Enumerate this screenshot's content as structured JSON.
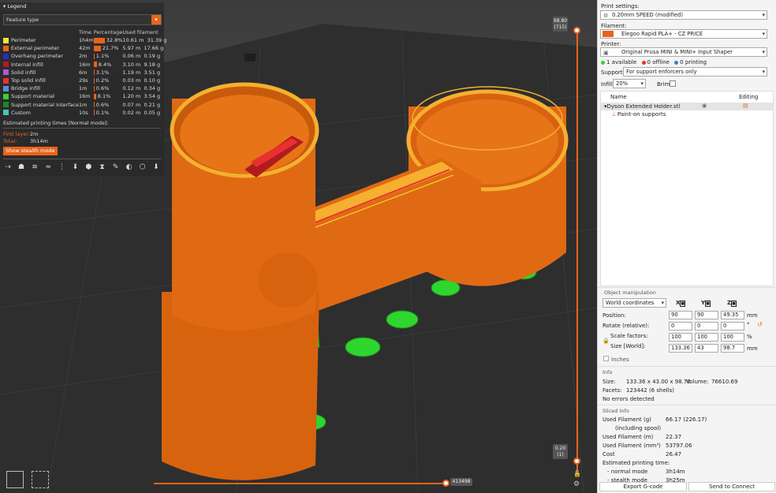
{
  "legend": {
    "title": "Legend",
    "view_type": "Feature type",
    "columns": [
      "Time",
      "Percentage",
      "Used filament"
    ],
    "rows": [
      {
        "name": "Perimeter",
        "color": "#f5e43a",
        "time": "1h4m",
        "pct": "32.8%",
        "pct_value": 32.8,
        "len": "10.61 m",
        "weight": "31.39 g"
      },
      {
        "name": "External perimeter",
        "color": "#e8641b",
        "time": "42m",
        "pct": "21.7%",
        "pct_value": 21.7,
        "len": "5.97 m",
        "weight": "17.66 g"
      },
      {
        "name": "Overhang perimeter",
        "color": "#2a2acc",
        "time": "2m",
        "pct": "1.1%",
        "pct_value": 1.1,
        "len": "0.06 m",
        "weight": "0.19 g"
      },
      {
        "name": "Internal infill",
        "color": "#b01c1c",
        "time": "16m",
        "pct": "8.4%",
        "pct_value": 8.4,
        "len": "3.10 m",
        "weight": "9.18 g"
      },
      {
        "name": "Solid infill",
        "color": "#a65ad6",
        "time": "6m",
        "pct": "3.1%",
        "pct_value": 3.1,
        "len": "1.19 m",
        "weight": "3.51 g"
      },
      {
        "name": "Top solid infill",
        "color": "#e83030",
        "time": "29s",
        "pct": "0.2%",
        "pct_value": 0.2,
        "len": "0.03 m",
        "weight": "0.10 g"
      },
      {
        "name": "Bridge infill",
        "color": "#5a8fd8",
        "time": "1m",
        "pct": "0.6%",
        "pct_value": 0.6,
        "len": "0.12 m",
        "weight": "0.34 g"
      },
      {
        "name": "Support material",
        "color": "#2ed62e",
        "time": "16m",
        "pct": "8.1%",
        "pct_value": 8.1,
        "len": "1.20 m",
        "weight": "3.54 g"
      },
      {
        "name": "Support material interface",
        "color": "#1a8a1a",
        "time": "1m",
        "pct": "0.6%",
        "pct_value": 0.6,
        "len": "0.07 m",
        "weight": "0.21 g"
      },
      {
        "name": "Custom",
        "color": "#4ac2b8",
        "time": "10s",
        "pct": "0.1%",
        "pct_value": 0.1,
        "len": "0.02 m",
        "weight": "0.05 g"
      }
    ],
    "estimated_label": "Estimated printing times [Normal mode]:",
    "first_layer_label": "First layer:",
    "first_layer_value": "2m",
    "total_label": "Total:",
    "total_value": "3h14m",
    "stealth_button": "Show stealth mode"
  },
  "slider": {
    "top_height": "98.80",
    "top_layer": "(715)",
    "bottom_height": "0.20",
    "bottom_layer": "(1)",
    "horizontal_value": "413498"
  },
  "panel": {
    "print_settings_label": "Print settings:",
    "print_settings_value": "0.20mm SPEED (modified)",
    "filament_label": "Filament:",
    "filament_value": "Elegoo Rapid PLA+ - CZ PRICE",
    "filament_color": "#e8641b",
    "printer_label": "Printer:",
    "printer_value": "Original Prusa MINI & MINI+ Input Shaper",
    "status_available": "1 available",
    "status_offline": "0 offline",
    "status_printing": "0 printing",
    "supports_label": "Supports:",
    "supports_value": "For support enforcers only",
    "infill_label": "Infill:",
    "infill_value": "20%",
    "brim_label": "Brim:",
    "list_col_name": "Name",
    "list_col_editing": "Editing",
    "object_name": "Dyson Extended Holder.stl",
    "object_child": "Paint-on supports",
    "manip_title": "Object manipulation",
    "coord_system": "World coordinates",
    "axis_x": "X",
    "axis_y": "Y",
    "axis_z": "Z",
    "position_label": "Position:",
    "position": [
      "90",
      "90",
      "49.35"
    ],
    "position_unit": "mm",
    "rotate_label": "Rotate (relative):",
    "rotate": [
      "0",
      "0",
      "0"
    ],
    "rotate_unit": "°",
    "scale_label": "Scale factors:",
    "scale": [
      "100",
      "100",
      "100"
    ],
    "scale_unit": "%",
    "size_label": "Size [World]:",
    "size": [
      "133.36",
      "43",
      "98.7"
    ],
    "size_unit": "mm",
    "inches_label": "Inches",
    "info_title": "Info",
    "info_size_label": "Size:",
    "info_size_value": "133.36 x 43.00 x 98.70",
    "info_volume_label": "Volume:",
    "info_volume_value": "76610.69",
    "info_facets_label": "Facets:",
    "info_facets_value": "123442 (6 shells)",
    "info_errors": "No errors detected",
    "sliced_title": "Sliced Info",
    "sliced_rows": [
      {
        "label": "Used Filament (g)",
        "value": "66.17 (226.17)"
      },
      {
        "label": "(including spool)",
        "value": ""
      },
      {
        "label": "Used Filament (m)",
        "value": "22.37"
      },
      {
        "label": "Used Filament (mm³)",
        "value": "53797.06"
      },
      {
        "label": "Cost",
        "value": "26.47"
      },
      {
        "label": "Estimated printing time:",
        "value": ""
      },
      {
        "label": "- normal mode",
        "value": "3h14m"
      },
      {
        "label": "- stealth mode",
        "value": "3h25m"
      }
    ],
    "export_button": "Export G-code",
    "connect_button": "Send to Connect"
  }
}
